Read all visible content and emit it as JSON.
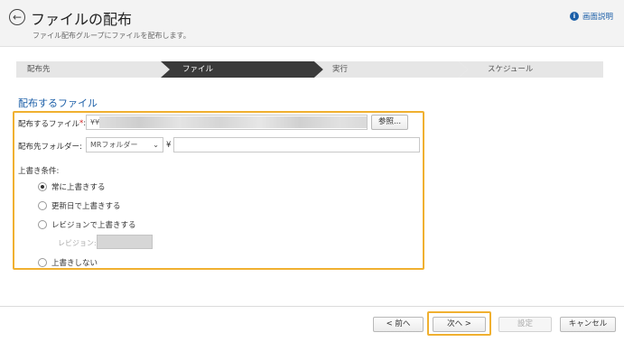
{
  "header": {
    "back_icon": "arrow-left-circle-icon",
    "title": "ファイルの配布",
    "subtitle": "ファイル配布グループにファイルを配布します。",
    "help_label": "画面説明",
    "help_icon": "info-icon"
  },
  "steps": [
    {
      "label": "配布先",
      "active": false
    },
    {
      "label": "ファイル",
      "active": true
    },
    {
      "label": "実行",
      "active": false
    },
    {
      "label": "スケジュール",
      "active": false
    }
  ],
  "section_title": "配布するファイル",
  "form": {
    "file_label": "配布するファイル",
    "required_mark": "*",
    "file_label_suffix": ":",
    "file_value_prefix": "¥¥",
    "browse_label": "参照...",
    "dest_label": "配布先フォルダー:",
    "dest_select_value": "MRフォルダー",
    "yen_sep": "¥",
    "dest_path_value": "",
    "overwrite_label": "上書き条件:",
    "overwrite_options": [
      {
        "label": "常に上書きする",
        "checked": true
      },
      {
        "label": "更新日で上書きする",
        "checked": false
      },
      {
        "label": "レビジョンで上書きする",
        "checked": false
      },
      {
        "label": "上書きしない",
        "checked": false
      }
    ],
    "revision_label": "レビジョン:"
  },
  "footer": {
    "prev_label": "< 前へ",
    "next_label": "次へ >",
    "set_label": "設定",
    "cancel_label": "キャンセル"
  },
  "colors": {
    "accent": "#1c5fa8",
    "highlight": "#f0b030",
    "step_active": "#3a3a3a",
    "step_inactive": "#e6e6e6"
  }
}
